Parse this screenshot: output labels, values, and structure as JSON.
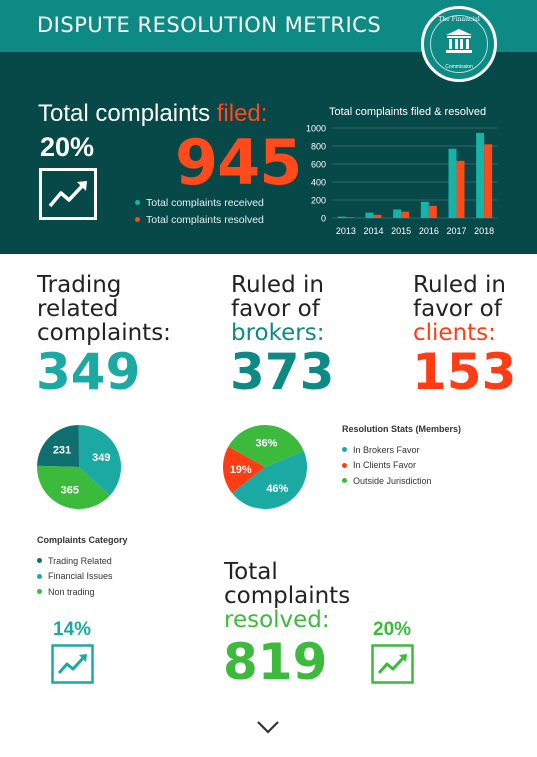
{
  "header": {
    "title": "DISPUTE RESOLUTION METRICS"
  },
  "logo": {
    "top_text": "The Financial",
    "bottom_text": "Commission"
  },
  "summary": {
    "heading": "Total complaints ",
    "heading_highlight": "filed:",
    "growth": "20%",
    "total_filed": "945",
    "legend": [
      "Total complaints received",
      "Total complaints resolved"
    ]
  },
  "colors": {
    "teal": "#1aa9a3",
    "dark_teal": "#0e8a84",
    "red": "#ff3c14",
    "green": "#3bba3c",
    "received": "#16b3a9",
    "resolved": "#ff4a1c"
  },
  "stats": {
    "trading": {
      "label_lines": [
        "Trading",
        "related",
        "complaints:"
      ],
      "value": "349"
    },
    "brokers": {
      "label_lines": [
        "Ruled in",
        "favor of"
      ],
      "highlight": "brokers:",
      "value": "373"
    },
    "clients": {
      "label_lines": [
        "Ruled in",
        "favor of"
      ],
      "highlight": "clients:",
      "value": "153"
    }
  },
  "resolution_legend": {
    "title": "Resolution Stats (Members)",
    "items": [
      "In Brokers Favor",
      "In Clients Favor",
      "Outside Jurisdiction"
    ]
  },
  "category_legend": {
    "title": "Complaints Category",
    "items": [
      "Trading Related",
      "Financial Issues",
      "Non trading"
    ]
  },
  "resolved": {
    "label_lines": [
      "Total",
      "complaints"
    ],
    "highlight": "resolved:",
    "value": "819",
    "left_pct": "14%",
    "right_pct": "20%"
  },
  "chart_data": [
    {
      "type": "bar",
      "title": "Total complaints filed & resolved",
      "categories": [
        "2013",
        "2014",
        "2015",
        "2016",
        "2017",
        "2018"
      ],
      "series": [
        {
          "name": "Total complaints received",
          "values": [
            15,
            60,
            95,
            180,
            770,
            945
          ]
        },
        {
          "name": "Total complaints resolved",
          "values": [
            8,
            35,
            70,
            135,
            635,
            819
          ]
        }
      ],
      "ylim": [
        0,
        1000
      ],
      "yticks": [
        0,
        200,
        400,
        600,
        800,
        1000
      ]
    },
    {
      "type": "pie",
      "labels": [
        "Trading Related",
        "Financial Issues",
        "Non trading"
      ],
      "values": [
        231,
        349,
        365
      ],
      "display": [
        "231",
        "349",
        "365"
      ]
    },
    {
      "type": "pie",
      "labels": [
        "In Brokers Favor",
        "In Clients Favor",
        "Outside Jurisdiction"
      ],
      "values": [
        46,
        19,
        36
      ],
      "display": [
        "46%",
        "19%",
        "36%"
      ]
    }
  ]
}
